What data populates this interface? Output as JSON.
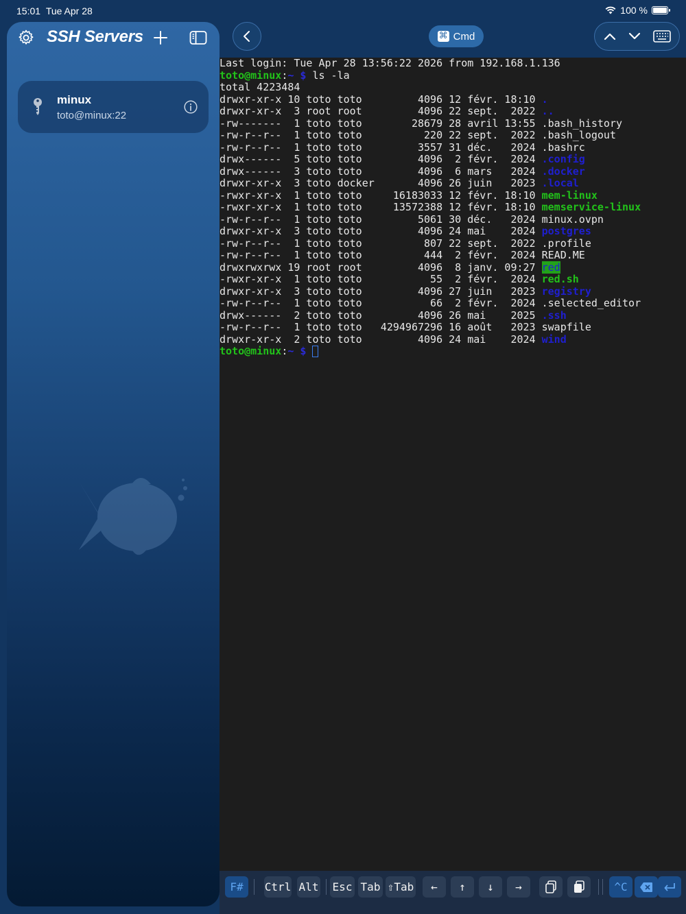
{
  "status_bar": {
    "time": "15:01",
    "date": "Tue Apr 28",
    "battery": "100 %",
    "battery_level": 1.0
  },
  "sidebar": {
    "title": "SSH Servers",
    "icons": [
      "gear-icon",
      "plus-icon",
      "sidebar-toggle-icon"
    ],
    "servers": [
      {
        "name": "minux",
        "address": "toto@minux:22"
      }
    ]
  },
  "toolbar": {
    "cmd_label": "Cmd",
    "cmd_glyph": "⌘"
  },
  "terminal": {
    "last_login": "Last login: Tue Apr 28 13:56:22 2026 from 192.168.1.136",
    "prompt_user": "toto@minux",
    "prompt_sep": ":",
    "prompt_path": "~ $",
    "command": " ls -la",
    "total": "total 4223484",
    "entries": [
      {
        "meta": "drwxr-xr-x 10 toto toto         4096 12 févr. 18:10 ",
        "name": ".",
        "kind": "dir"
      },
      {
        "meta": "drwxr-xr-x  3 root root         4096 22 sept.  2022 ",
        "name": "..",
        "kind": "dir"
      },
      {
        "meta": "-rw-------  1 toto toto        28679 28 avril 13:55 ",
        "name": ".bash_history",
        "kind": "plain"
      },
      {
        "meta": "-rw-r--r--  1 toto toto          220 22 sept.  2022 ",
        "name": ".bash_logout",
        "kind": "plain"
      },
      {
        "meta": "-rw-r--r--  1 toto toto         3557 31 déc.   2024 ",
        "name": ".bashrc",
        "kind": "plain"
      },
      {
        "meta": "drwx------  5 toto toto         4096  2 févr.  2024 ",
        "name": ".config",
        "kind": "dir"
      },
      {
        "meta": "drwx------  3 toto toto         4096  6 mars   2024 ",
        "name": ".docker",
        "kind": "dir"
      },
      {
        "meta": "drwxr-xr-x  3 toto docker       4096 26 juin   2023 ",
        "name": ".local",
        "kind": "dir"
      },
      {
        "meta": "-rwxr-xr-x  1 toto toto     16183033 12 févr. 18:10 ",
        "name": "mem-linux",
        "kind": "exe"
      },
      {
        "meta": "-rwxr-xr-x  1 toto toto     13572388 12 févr. 18:10 ",
        "name": "memservice-linux",
        "kind": "exe"
      },
      {
        "meta": "-rw-r--r--  1 toto toto         5061 30 déc.   2024 ",
        "name": "minux.ovpn",
        "kind": "plain"
      },
      {
        "meta": "drwxr-xr-x  3 toto toto         4096 24 mai    2024 ",
        "name": "postgres",
        "kind": "dir"
      },
      {
        "meta": "-rw-r--r--  1 toto toto          807 22 sept.  2022 ",
        "name": ".profile",
        "kind": "plain"
      },
      {
        "meta": "-rw-r--r--  1 toto toto          444  2 févr.  2024 ",
        "name": "READ.ME",
        "kind": "plain"
      },
      {
        "meta": "drwxrwxrwx 19 root root         4096  8 janv. 09:27 ",
        "name": "red",
        "kind": "sticky"
      },
      {
        "meta": "-rwxr-xr-x  1 toto toto           55  2 févr.  2024 ",
        "name": "red.sh",
        "kind": "exe"
      },
      {
        "meta": "drwxr-xr-x  3 toto toto         4096 27 juin   2023 ",
        "name": "registry",
        "kind": "dir"
      },
      {
        "meta": "-rw-r--r--  1 toto toto           66  2 févr.  2024 ",
        "name": ".selected_editor",
        "kind": "plain"
      },
      {
        "meta": "drwx------  2 toto toto         4096 26 mai    2025 ",
        "name": ".ssh",
        "kind": "dir"
      },
      {
        "meta": "-rw-r--r--  1 toto toto   4294967296 16 août   2023 ",
        "name": "swapfile",
        "kind": "plain"
      },
      {
        "meta": "drwxr-xr-x  2 toto toto         4096 24 mai    2024 ",
        "name": "wind",
        "kind": "dir"
      }
    ]
  },
  "keybar": {
    "keys": [
      "F#",
      "Ctrl",
      "Alt",
      "Esc",
      "Tab",
      "⇧Tab",
      "←",
      "↑",
      "↓",
      "→",
      "copy-icon",
      "paste-icon",
      "^C",
      "delete-icon",
      "return-icon"
    ]
  },
  "colors": {
    "terminal_bg": "#1d1d1d",
    "prompt_green": "#22c21a",
    "dir_blue": "#1f1fcf",
    "accent": "#2d6aa8"
  }
}
